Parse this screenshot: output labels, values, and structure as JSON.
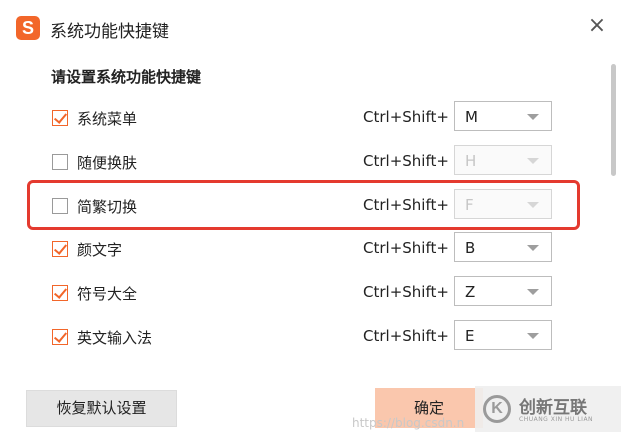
{
  "window": {
    "logo_glyph": "S",
    "title": "系统功能快捷键",
    "close_glyph": "×"
  },
  "section": {
    "title": "请设置系统功能快捷键"
  },
  "shortcuts": [
    {
      "label": "系统菜单",
      "checked": true,
      "modifier": "Ctrl+Shift+",
      "key": "M",
      "enabled": true
    },
    {
      "label": "随便换肤",
      "checked": false,
      "modifier": "Ctrl+Shift+",
      "key": "H",
      "enabled": false
    },
    {
      "label": "简繁切换",
      "checked": false,
      "modifier": "Ctrl+Shift+",
      "key": "F",
      "enabled": false
    },
    {
      "label": "颜文字",
      "checked": true,
      "modifier": "Ctrl+Shift+",
      "key": "B",
      "enabled": true
    },
    {
      "label": "符号大全",
      "checked": true,
      "modifier": "Ctrl+Shift+",
      "key": "Z",
      "enabled": true
    },
    {
      "label": "英文输入法",
      "checked": true,
      "modifier": "Ctrl+Shift+",
      "key": "E",
      "enabled": true
    }
  ],
  "buttons": {
    "reset": "恢复默认设置",
    "ok": "确定"
  },
  "watermark": {
    "url": "https://blog.csdn.n",
    "logo_mark": "K",
    "logo_cn": "创新互联",
    "logo_en": "CHUANG XIN HU LIAN"
  },
  "colors": {
    "accent": "#f2662a",
    "highlight_box": "#e43a2f",
    "ok_button": "#fac7ad",
    "reset_button": "#e6e6e6"
  }
}
